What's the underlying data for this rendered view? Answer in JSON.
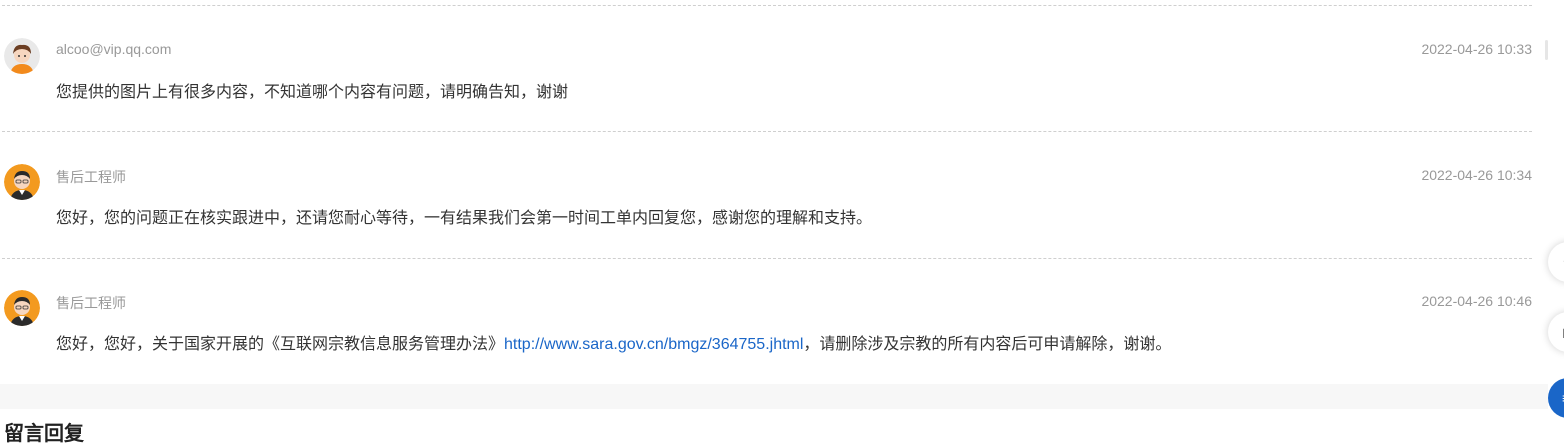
{
  "messages": [
    {
      "author": "alcoo@vip.qq.com",
      "avatar": "user-avatar",
      "time": "2022-04-26 10:33",
      "text": "您提供的图片上有很多内容，不知道哪个内容有问题，请明确告知，谢谢"
    },
    {
      "author": "售后工程师",
      "avatar": "engineer-avatar",
      "time": "2022-04-26 10:34",
      "text": "您好，您的问题正在核实跟进中，还请您耐心等待，一有结果我们会第一时间工单内回复您，感谢您的理解和支持。"
    },
    {
      "author": "售后工程师",
      "avatar": "engineer-avatar",
      "time": "2022-04-26 10:46",
      "text_before": "您好，您好，关于国家开展的《互联网宗教信息服务管理办法》",
      "link": "http://www.sara.gov.cn/bmgz/364755.jhtml",
      "text_after": "，请删除涉及宗教的所有内容后可申请解除，谢谢。"
    }
  ],
  "section_title": "留言回复",
  "side_buttons": [
    {
      "icon": "up-arrow-icon",
      "glyph": "↑"
    },
    {
      "icon": "copy-icon",
      "glyph": "◻"
    },
    {
      "icon": "menu-icon",
      "glyph": "≡"
    }
  ],
  "colors": {
    "link": "#1a66c8",
    "meta_text": "#999999",
    "body_text": "#333333",
    "primary_button": "#1a66c8"
  }
}
